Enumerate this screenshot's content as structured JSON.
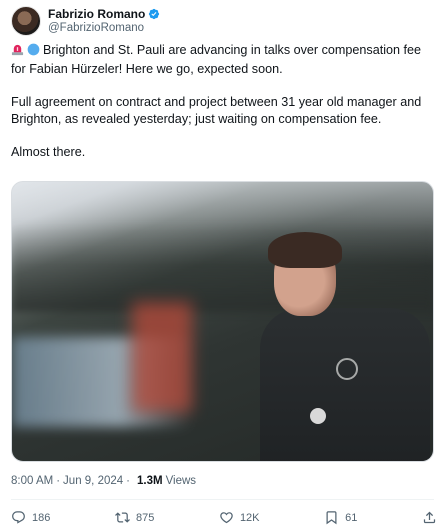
{
  "author": {
    "display_name": "Fabrizio Romano",
    "handle": "@FabrizioRomano"
  },
  "tweet": {
    "paragraph1": "Brighton and St. Pauli are advancing in talks over compensation fee for Fabian Hürzeler! Here we go, expected soon.",
    "paragraph2": "Full agreement on contract and project between 31 year old manager and Brighton, as revealed yesterday; just waiting on compensation fee.",
    "paragraph3": "Almost there."
  },
  "meta": {
    "time": "8:00 AM",
    "date": "Jun 9, 2024",
    "separator": "·",
    "views_count": "1.3M",
    "views_label": "Views"
  },
  "actions": {
    "replies": "186",
    "reposts": "875",
    "likes": "12K",
    "bookmarks": "61"
  },
  "colors": {
    "verified": "#1d9bf0",
    "text": "#0f1419",
    "secondary": "#536471",
    "siren": "#e0245e",
    "blue_circle": "#55acee"
  }
}
